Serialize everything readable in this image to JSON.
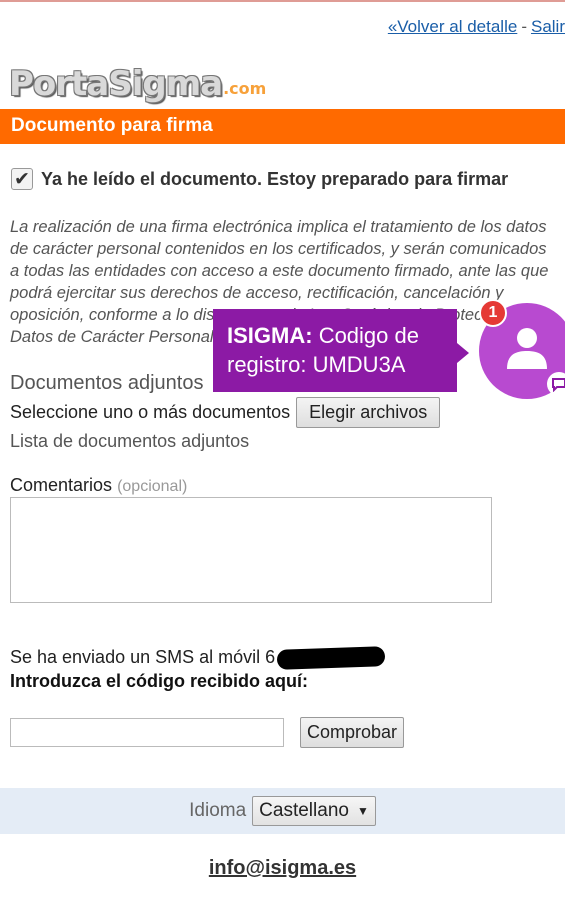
{
  "header": {
    "back_link": "«Volver al detalle",
    "separator": "-",
    "exit_link": "Salir"
  },
  "logo": {
    "main": "PortaSigma",
    "suffix": ".com"
  },
  "banner": {
    "title": "Documento para firma"
  },
  "confirm": {
    "label": "Ya he leído el documento. Estoy preparado para firmar",
    "checked": true
  },
  "legal_text": "La realización de una firma electrónica implica el tratamiento de los datos de carácter personal contenidos en los certificados, y serán comunicados a todas las entidades con acceso a este documento firmado, ante las que podrá ejercitar sus derechos de acceso, rectificación, cancelación y oposición, conforme a lo dispuesto en la Ley Orgánica de Protección de Datos de Carácter Personal.",
  "attachments": {
    "title": "Documentos adjuntos",
    "select_label": "Seleccione uno o más documentos",
    "choose_button": "Elegir archivos",
    "list_link": "Lista de documentos adjuntos"
  },
  "comments": {
    "label": "Comentarios",
    "optional": "(opcional)",
    "value": ""
  },
  "sms": {
    "sent_text": "Se ha enviado un SMS al móvil 6",
    "prompt": "Introduzca el código recibido aquí:",
    "code_value": "",
    "check_button": "Comprobar"
  },
  "language": {
    "label": "Idioma",
    "selected": "Castellano",
    "caret": "▼"
  },
  "footer": {
    "email": "info@isigma.es"
  },
  "notification": {
    "sender": "ISIGMA:",
    "message": "Codigo de registro: UMDU3A",
    "badge_count": "1",
    "colors": {
      "bubble": "#8c1aa5",
      "chathead": "#b84ad0",
      "badge": "#e53935"
    }
  },
  "colors": {
    "accent": "#ff6a00",
    "link": "#1a5ea8",
    "lang_bar": "#e4ecf6"
  }
}
